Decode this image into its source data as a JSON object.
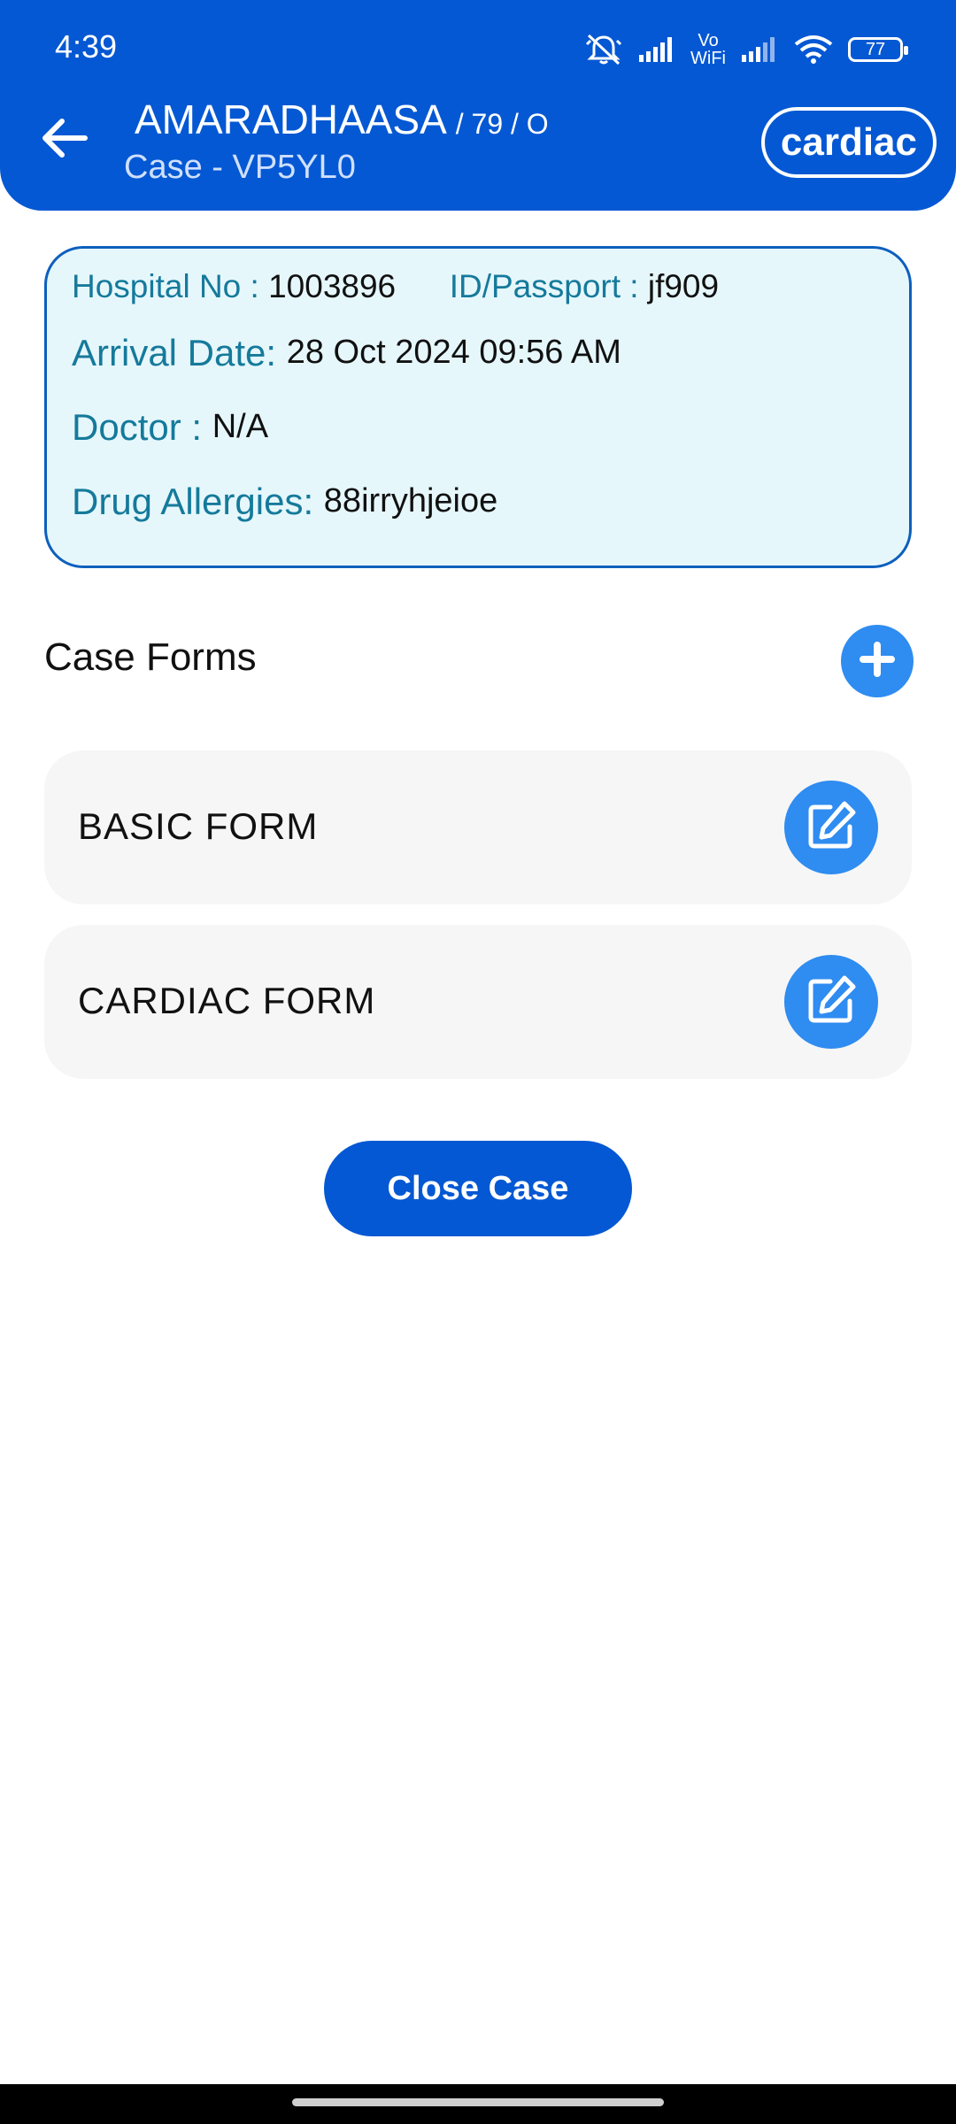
{
  "status_bar": {
    "time": "4:39",
    "battery": "77",
    "icons": [
      "muted-bell-icon",
      "signal-icon",
      "vowifi-icon",
      "signal-icon",
      "wifi-icon",
      "battery-icon"
    ],
    "vowifi_top": "Vo",
    "vowifi_bottom": "WiFi"
  },
  "header": {
    "back_icon": "arrow-left-icon",
    "patient_name": "AMARADHAASA",
    "patient_meta": "/ 79 / O",
    "case_id": "Case - VP5YL0",
    "category": "cardiac",
    "colors": {
      "background": "#0558d3",
      "text": "#ffffff"
    }
  },
  "info": {
    "hospital_no_label": "Hospital No :",
    "hospital_no": "1003896",
    "id_passport_label": "ID/Passport :",
    "id_passport": "jf909",
    "arrival_label": "Arrival Date:",
    "arrival_value": "28 Oct 2024 09:56 AM",
    "doctor_label": "Doctor :",
    "doctor_value": "N/A",
    "allergies_label": "Drug Allergies:",
    "allergies_value": "88irryhjeioe",
    "colors": {
      "background": "#e6f7fc",
      "border": "#0d5fbd",
      "label": "#157a9b"
    }
  },
  "case_forms": {
    "title": "Case Forms",
    "add_icon": "plus-icon",
    "forms": [
      {
        "label": "BASIC FORM",
        "icon": "edit-icon"
      },
      {
        "label": "CARDIAC FORM",
        "icon": "edit-icon"
      }
    ],
    "accent": "#2f8cf0"
  },
  "actions": {
    "close_case": "Close Case"
  }
}
